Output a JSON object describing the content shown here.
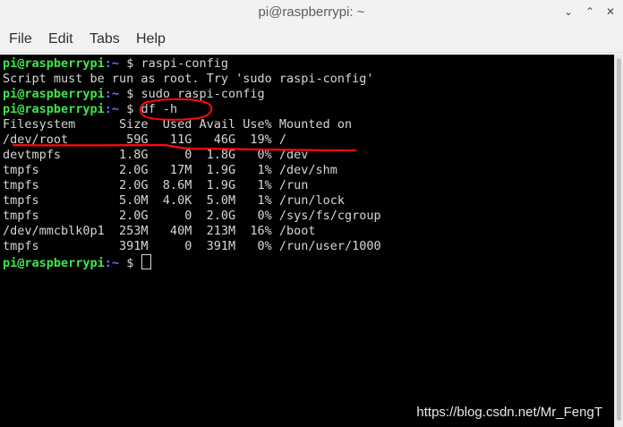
{
  "window": {
    "title": "pi@raspberrypi: ~",
    "min_glyph": "⌄",
    "max_glyph": "⌃",
    "close_glyph": "✕"
  },
  "menu": {
    "file": "File",
    "edit": "Edit",
    "tabs": "Tabs",
    "help": "Help"
  },
  "terminal": {
    "prompt_user": "pi@raspberrypi",
    "prompt_path": ":~ ",
    "prompt_symbol": "$ ",
    "cmd1": "raspi-config",
    "out1": "Script must be run as root. Try 'sudo raspi-config'",
    "cmd2": "sudo raspi-config",
    "cmd3": "df -h",
    "df_header": "Filesystem      Size  Used Avail Use% Mounted on",
    "df_rows": [
      "/dev/root        59G   11G   46G  19% /",
      "devtmpfs        1.8G     0  1.8G   0% /dev",
      "tmpfs           2.0G   17M  1.9G   1% /dev/shm",
      "tmpfs           2.0G  8.6M  1.9G   1% /run",
      "tmpfs           5.0M  4.0K  5.0M   1% /run/lock",
      "tmpfs           2.0G     0  2.0G   0% /sys/fs/cgroup",
      "/dev/mmcblk0p1  253M   40M  213M  16% /boot",
      "tmpfs           391M     0  391M   0% /run/user/1000"
    ]
  },
  "colors": {
    "prompt_user": "#3ee64a",
    "prompt_path": "#5b7bff",
    "annotation": "#ff0a0a",
    "terminal_bg": "#000000"
  },
  "watermark": "https://blog.csdn.net/Mr_FengT"
}
